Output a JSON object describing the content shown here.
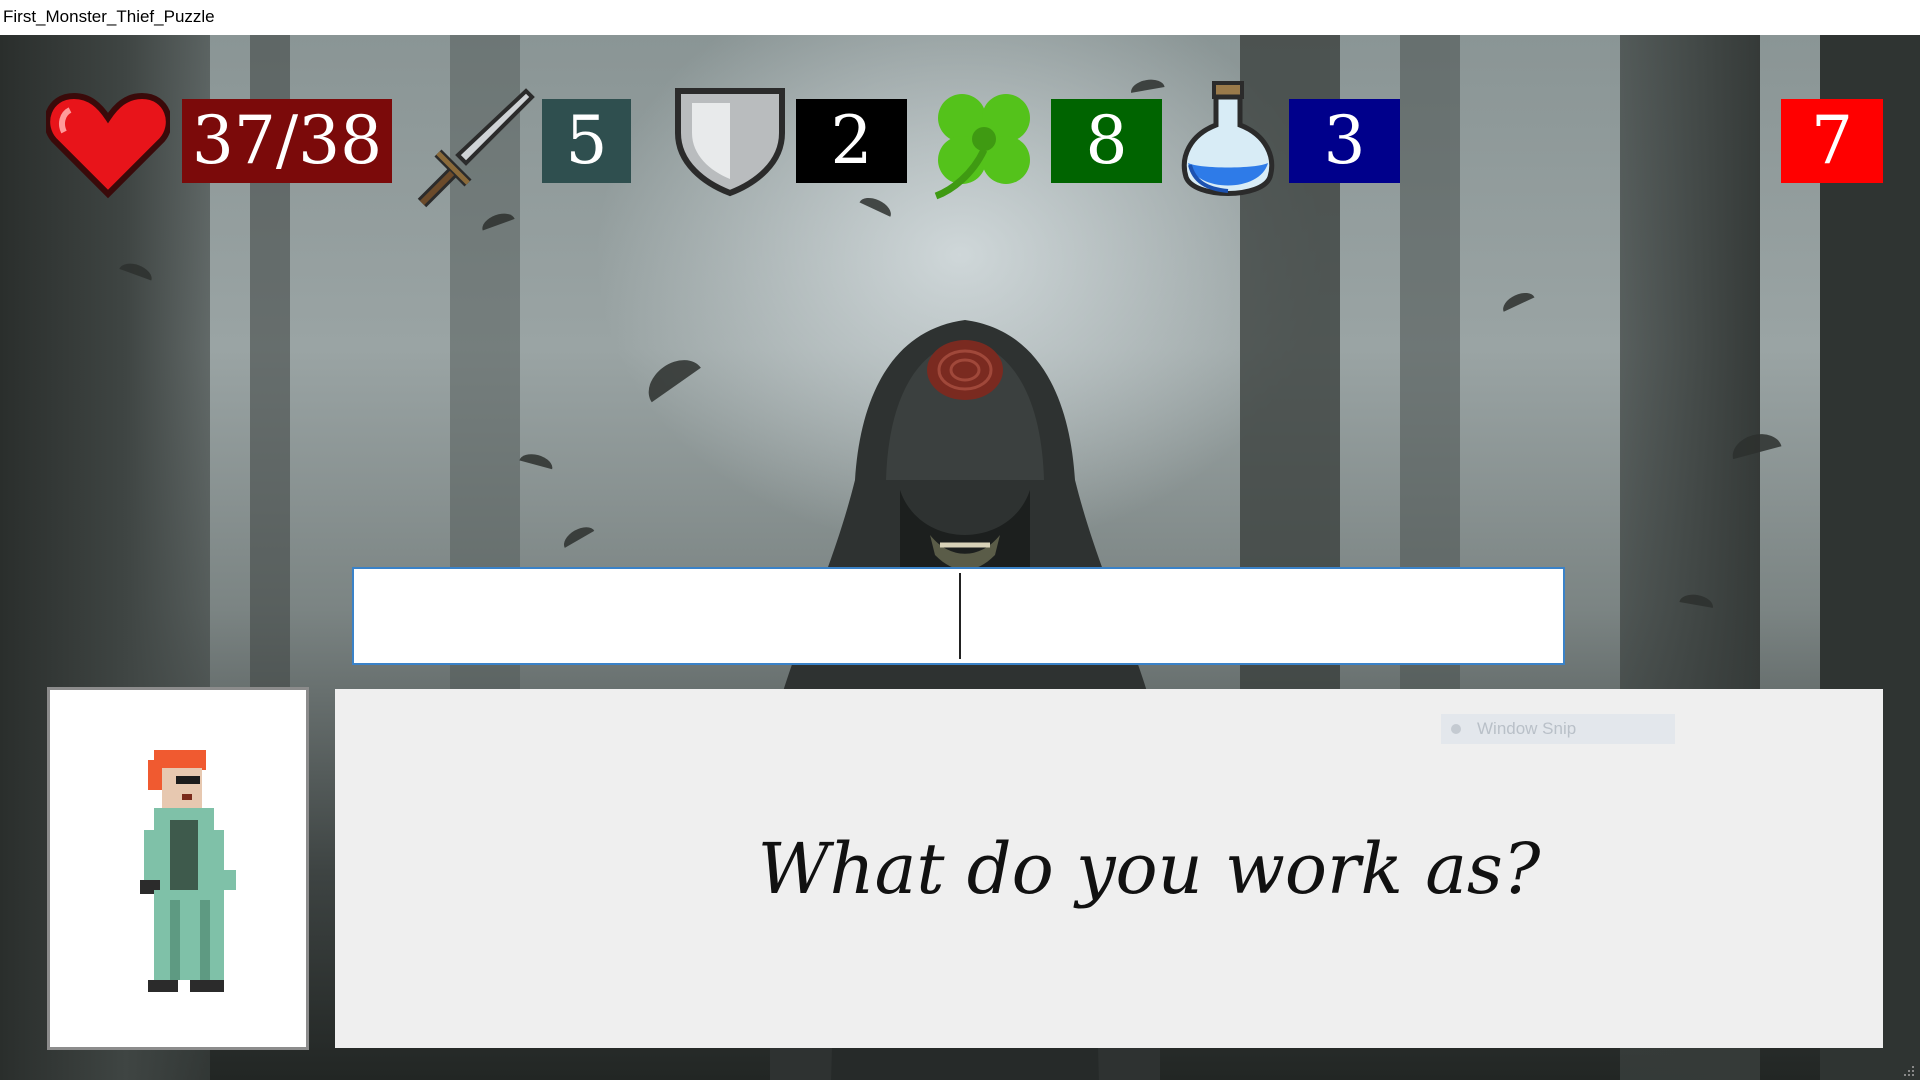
{
  "window": {
    "title": "First_Monster_Thief_Puzzle"
  },
  "stats": {
    "health": {
      "icon": "heart-icon",
      "value": "37/38",
      "color": "#7b0a0a"
    },
    "attack": {
      "icon": "sword-icon",
      "value": "5",
      "color": "#2f4f4f"
    },
    "defense": {
      "icon": "shield-icon",
      "value": "2",
      "color": "#000000"
    },
    "luck": {
      "icon": "clover-icon",
      "value": "8",
      "color": "#006400"
    },
    "potions": {
      "icon": "potion-icon",
      "value": "3",
      "color": "#00008b"
    },
    "counter": {
      "value": "7",
      "color": "#ff0000"
    }
  },
  "answer": {
    "value": ""
  },
  "dialogue": {
    "text": "What do you work as?"
  },
  "overlay": {
    "snip_label": "Window Snip"
  }
}
